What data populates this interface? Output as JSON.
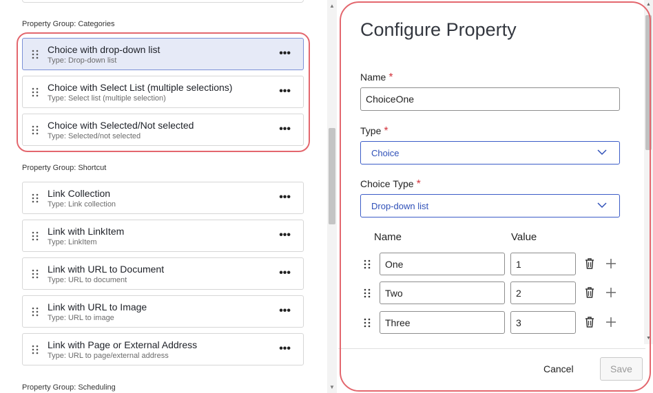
{
  "left_panel": {
    "groups": [
      {
        "label": "Property Group: Categories",
        "items": [
          {
            "title": "Choice with drop-down list",
            "subtype": "Type: Drop-down list",
            "selected": true
          },
          {
            "title": "Choice with Select List (multiple selections)",
            "subtype": "Type: Select list (multiple selection)",
            "selected": false
          },
          {
            "title": "Choice with Selected/Not selected",
            "subtype": "Type: Selected/not selected",
            "selected": false
          }
        ]
      },
      {
        "label": "Property Group: Shortcut",
        "items": [
          {
            "title": "Link Collection",
            "subtype": "Type: Link collection",
            "selected": false
          },
          {
            "title": "Link with LinkItem",
            "subtype": "Type: LinkItem",
            "selected": false
          },
          {
            "title": "Link with URL to Document",
            "subtype": "Type: URL to document",
            "selected": false
          },
          {
            "title": "Link with URL to Image",
            "subtype": "Type: URL to image",
            "selected": false
          },
          {
            "title": "Link with Page or External Address",
            "subtype": "Type: URL to page/external address",
            "selected": false
          }
        ]
      },
      {
        "label": "Property Group: Scheduling",
        "items": []
      }
    ],
    "more_glyph": "•••"
  },
  "dialog": {
    "title": "Configure Property",
    "required_mark": "*",
    "name_label": "Name",
    "name_value": "ChoiceOne",
    "type_label": "Type",
    "type_value": "Choice",
    "choice_type_label": "Choice Type",
    "choice_type_value": "Drop-down list",
    "col_name": "Name",
    "col_value": "Value",
    "options": [
      {
        "name": "One",
        "value": "1"
      },
      {
        "name": "Two",
        "value": "2"
      },
      {
        "name": "Three",
        "value": "3"
      }
    ],
    "cancel_label": "Cancel",
    "save_label": "Save"
  },
  "colors": {
    "accent": "#3a5bc7",
    "highlight": "#e3666d",
    "selected_bg": "#e6eaf7",
    "required": "#d3343d"
  }
}
